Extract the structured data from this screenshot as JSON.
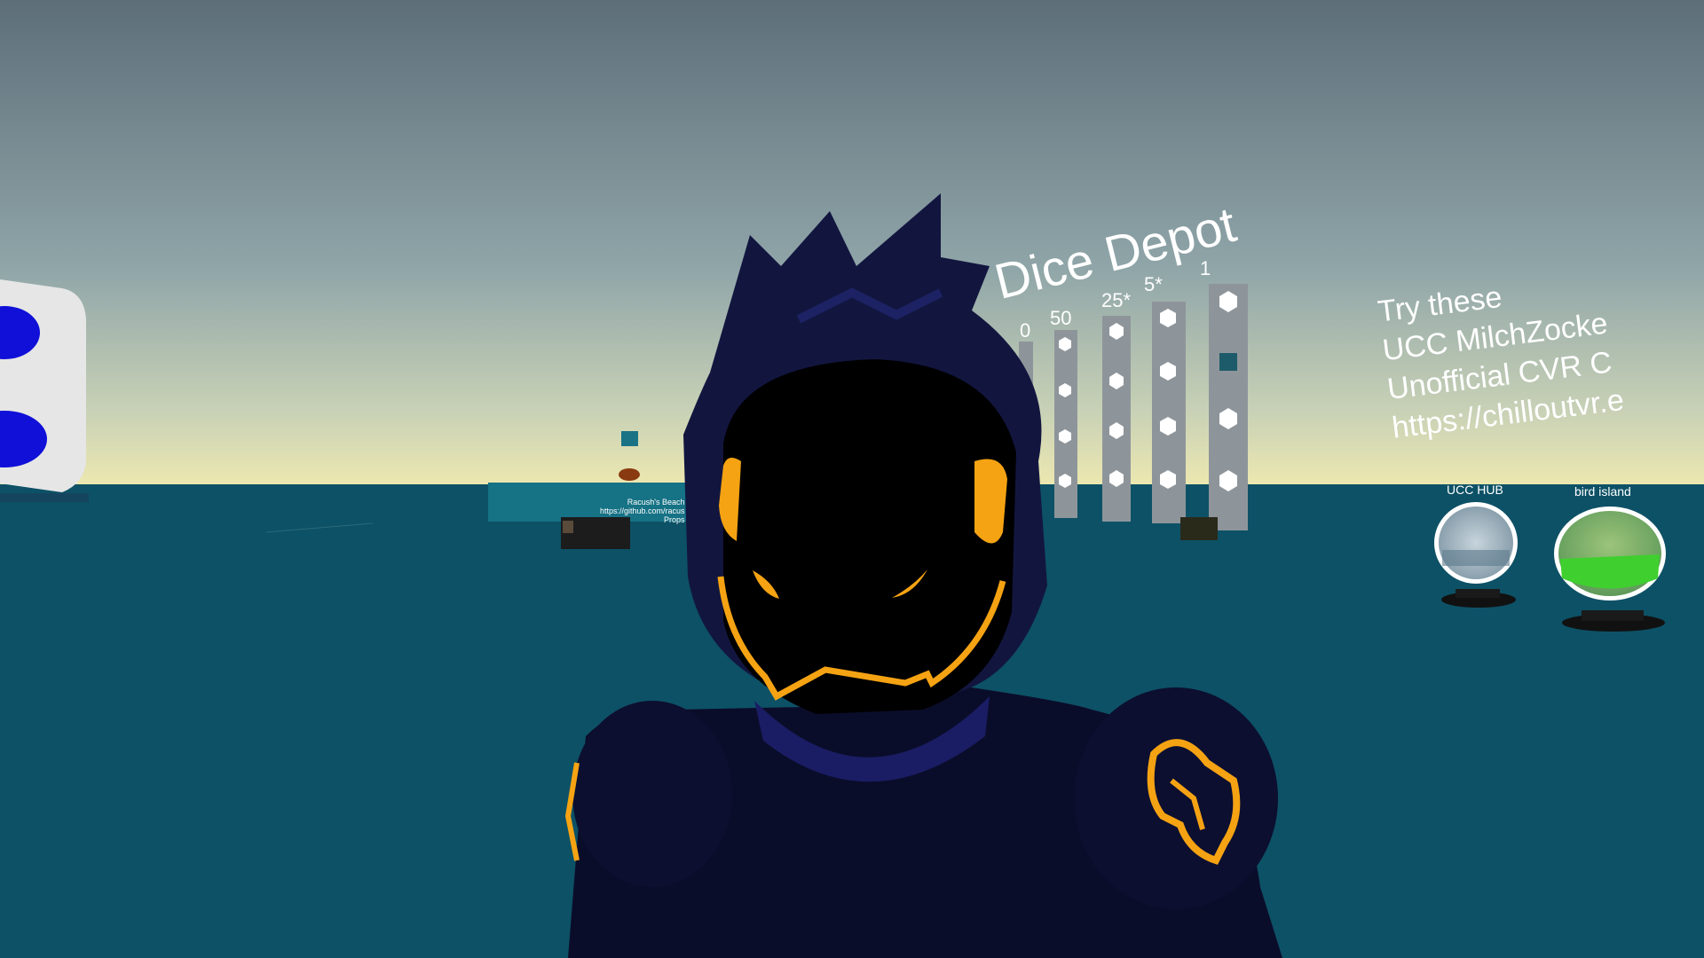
{
  "world": {
    "sign_title": "Dice Depot",
    "dice_columns": [
      {
        "label": "50"
      },
      {
        "label": "25*"
      },
      {
        "label": "5*"
      },
      {
        "label": "1"
      }
    ],
    "partial_column_label": "0",
    "info_board": {
      "lines": [
        "Try these",
        "UCC MilchZocke",
        "Unofficial CVR C",
        "https://chilloutvr.e"
      ]
    },
    "portals": [
      {
        "name": "UCC HUB"
      },
      {
        "name": "bird island"
      }
    ],
    "beach_sign": {
      "lines": [
        "Racush's Beach",
        "https://github.com/racus",
        "Props"
      ]
    }
  },
  "colors": {
    "sky_top": "#5e6f7a",
    "sky_horizon": "#e9e6b3",
    "ocean": "#0d5166",
    "avatar_body": "#0a0d2a",
    "avatar_accent": "#f5a313",
    "avatar_hair": "#12163f"
  }
}
